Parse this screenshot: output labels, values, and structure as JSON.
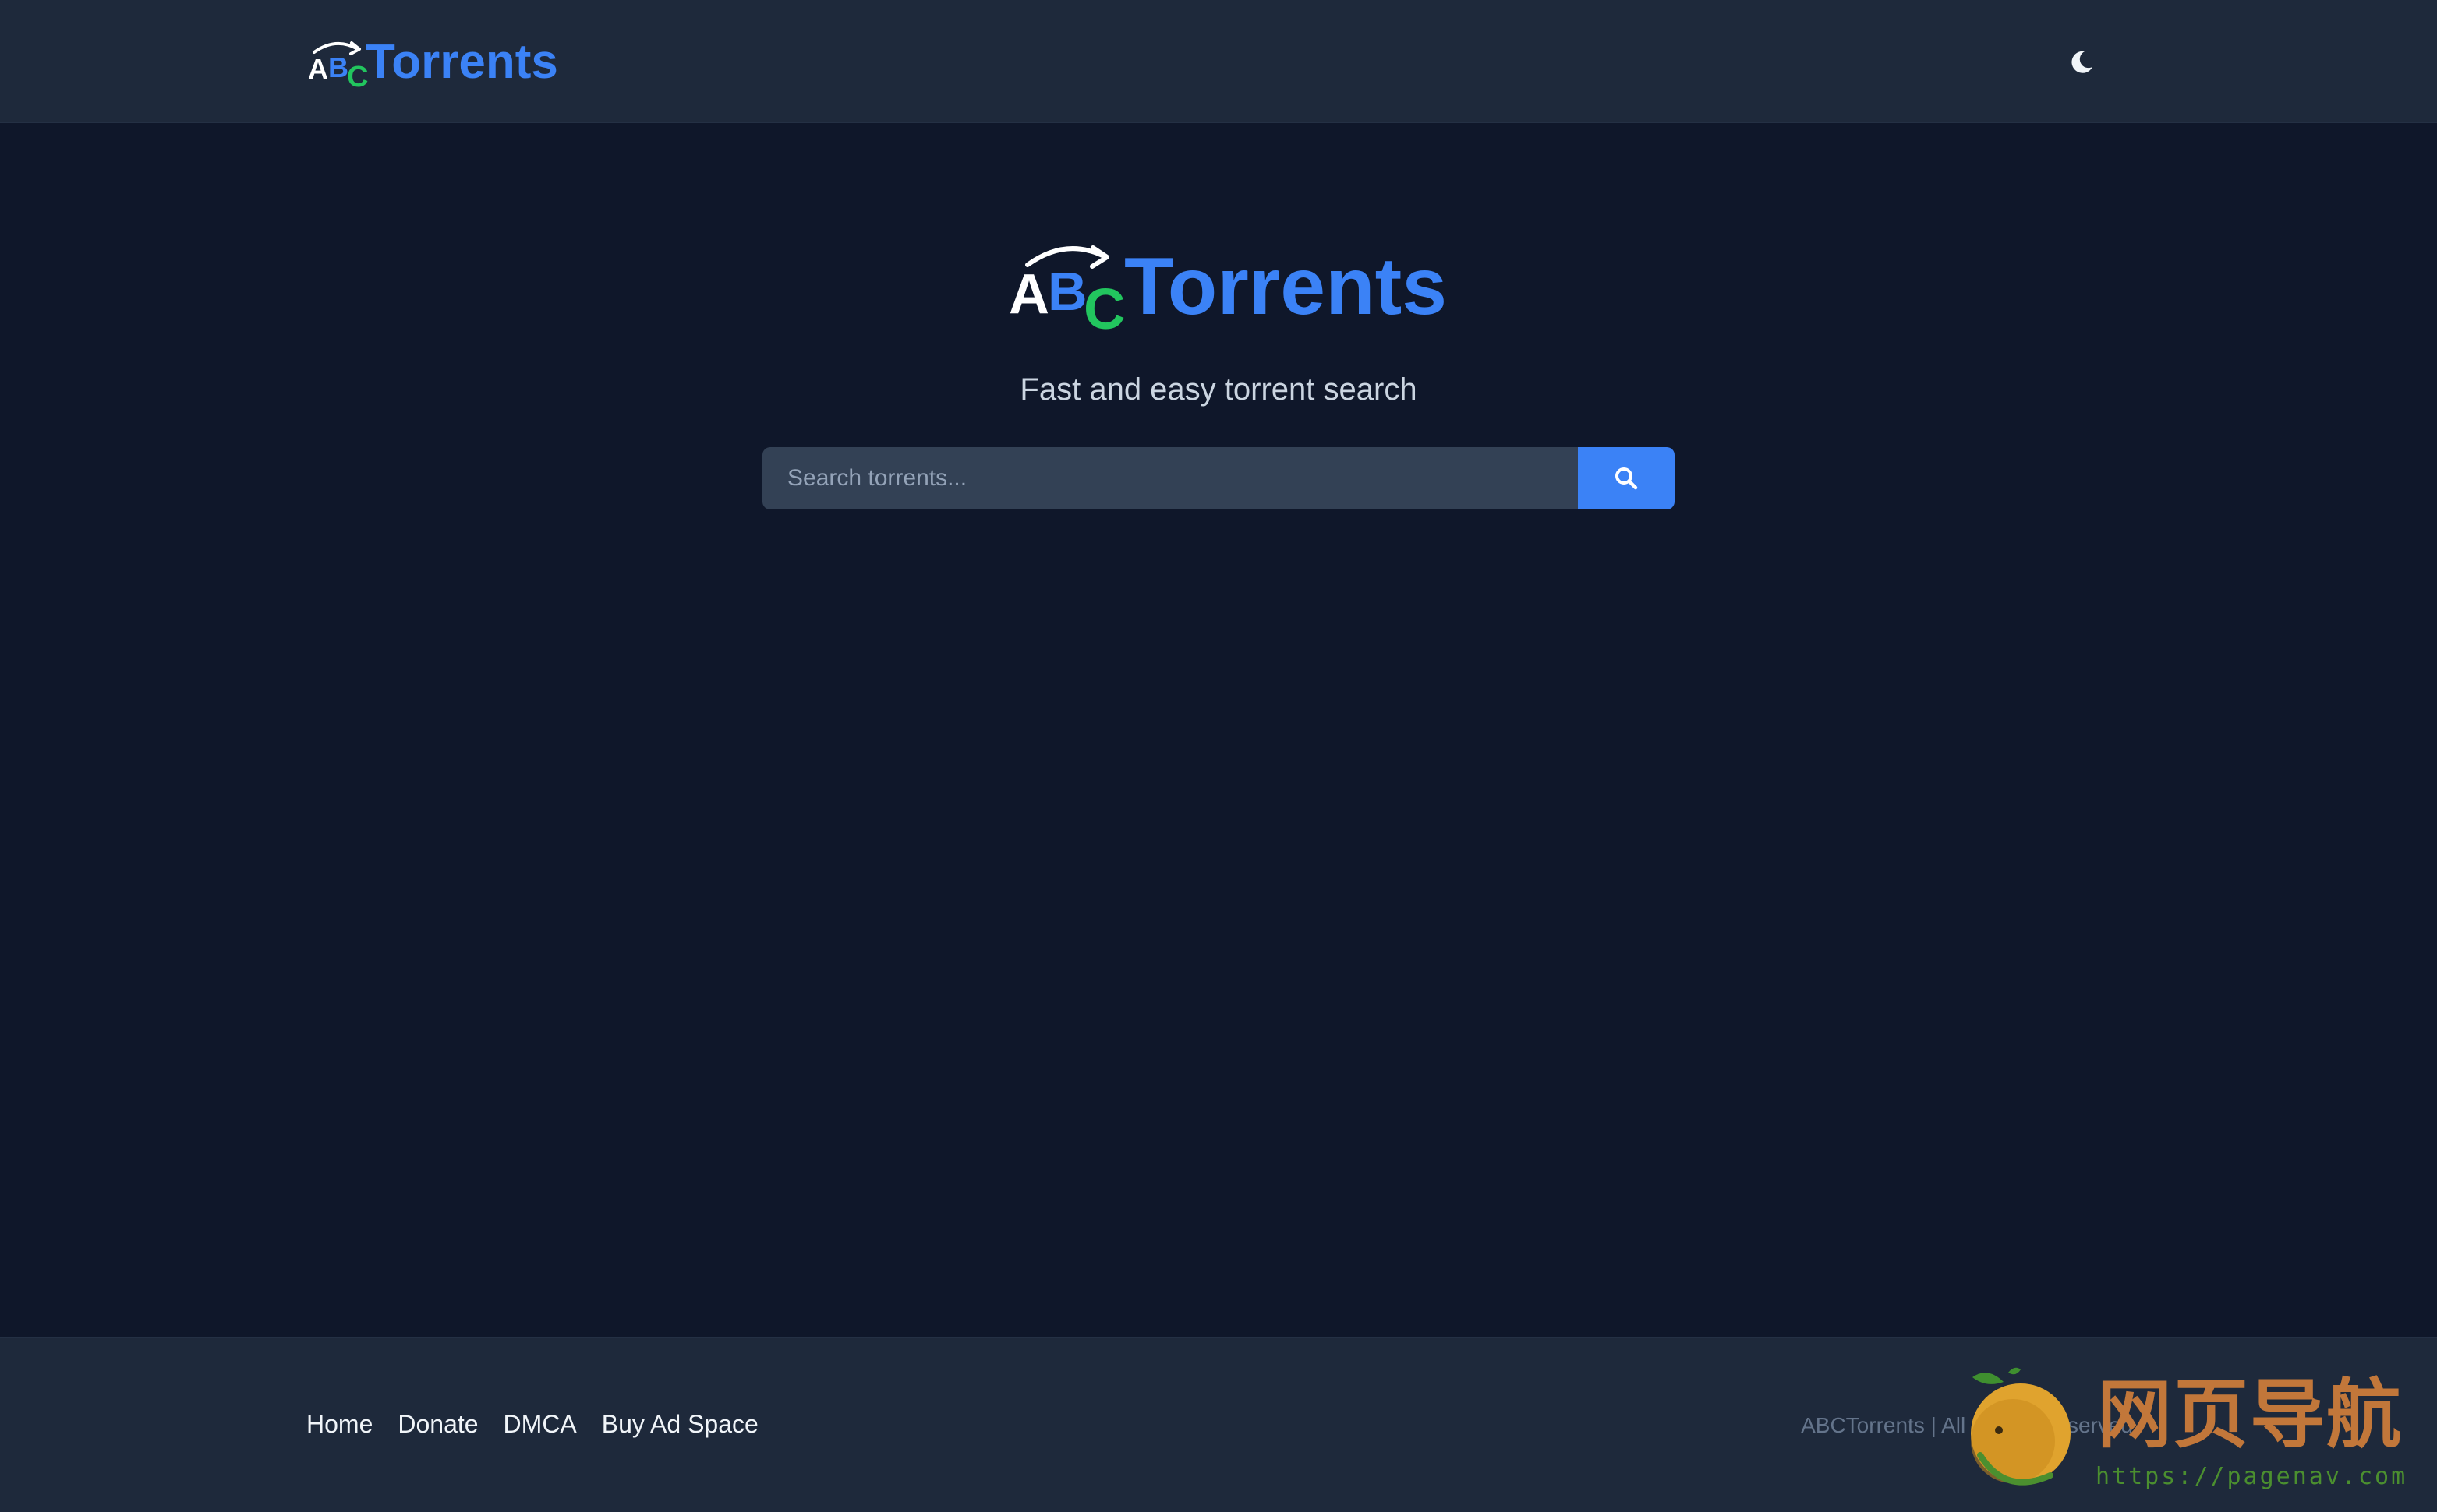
{
  "header": {
    "logo_letters": [
      "A",
      "B",
      "C"
    ],
    "logo_text": "Torrents",
    "theme_toggle_icon": "moon-icon"
  },
  "hero": {
    "logo_letters": [
      "A",
      "B",
      "C"
    ],
    "logo_text": "Torrents",
    "tagline": "Fast and easy torrent search"
  },
  "search": {
    "placeholder": "Search torrents...",
    "value": "",
    "button_icon": "search-icon"
  },
  "footer": {
    "links": [
      "Home",
      "Donate",
      "DMCA",
      "Buy Ad Space"
    ],
    "copyright": "ABCTorrents | All Rights Reserved"
  },
  "watermark": {
    "text": "网页导航",
    "url": "https://pagenav.com"
  },
  "colors": {
    "background": "#0f172a",
    "header_footer": "#1e293b",
    "accent": "#3b82f6",
    "logo_a": "#ffffff",
    "logo_b": "#3b82f6",
    "logo_c": "#22c55e",
    "input_bg": "#334155"
  }
}
